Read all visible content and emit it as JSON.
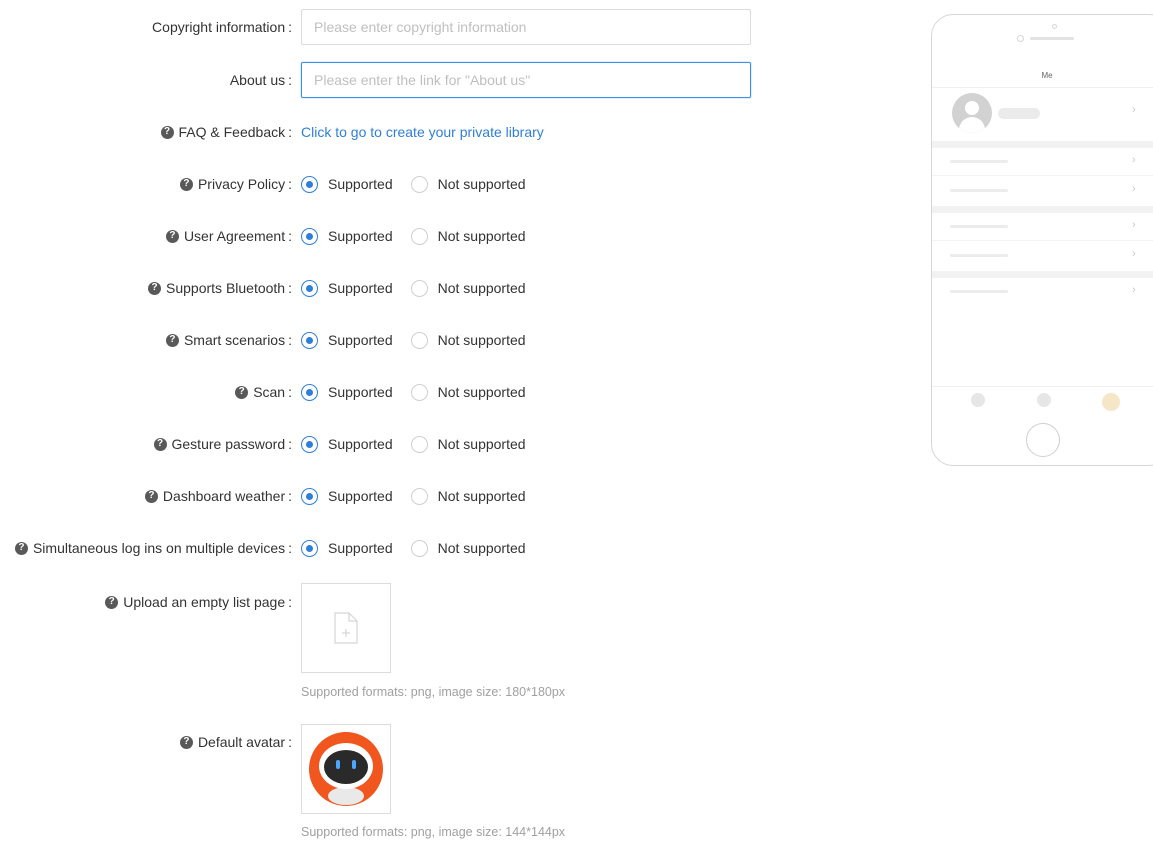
{
  "form": {
    "copyright": {
      "label": "Copyright information",
      "placeholder": "Please enter copyright information",
      "value": ""
    },
    "about": {
      "label": "About us",
      "placeholder": "Please enter the link for \"About us\"",
      "value": ""
    },
    "faq": {
      "label": "FAQ & Feedback",
      "link_text": "Click to go to create your private library"
    },
    "radio_options": {
      "supported": "Supported",
      "not_supported": "Not supported"
    },
    "toggles": [
      {
        "label": "Privacy Policy",
        "selected": "Supported"
      },
      {
        "label": "User Agreement",
        "selected": "Supported"
      },
      {
        "label": "Supports Bluetooth",
        "selected": "Supported"
      },
      {
        "label": "Smart scenarios",
        "selected": "Supported"
      },
      {
        "label": "Scan",
        "selected": "Supported"
      },
      {
        "label": "Gesture password",
        "selected": "Supported"
      },
      {
        "label": "Dashboard weather",
        "selected": "Supported"
      },
      {
        "label": "Simultaneous log ins on multiple devices",
        "selected": "Supported"
      }
    ],
    "empty_list": {
      "label": "Upload an empty list page",
      "hint": "Supported formats: png, image size: 180*180px"
    },
    "avatar": {
      "label": "Default avatar",
      "hint": "Supported formats: png, image size: 144*144px"
    }
  },
  "preview": {
    "title": "Me"
  },
  "colors": {
    "accent": "#2f7fd8",
    "avatar_orange": "#f0561e"
  }
}
